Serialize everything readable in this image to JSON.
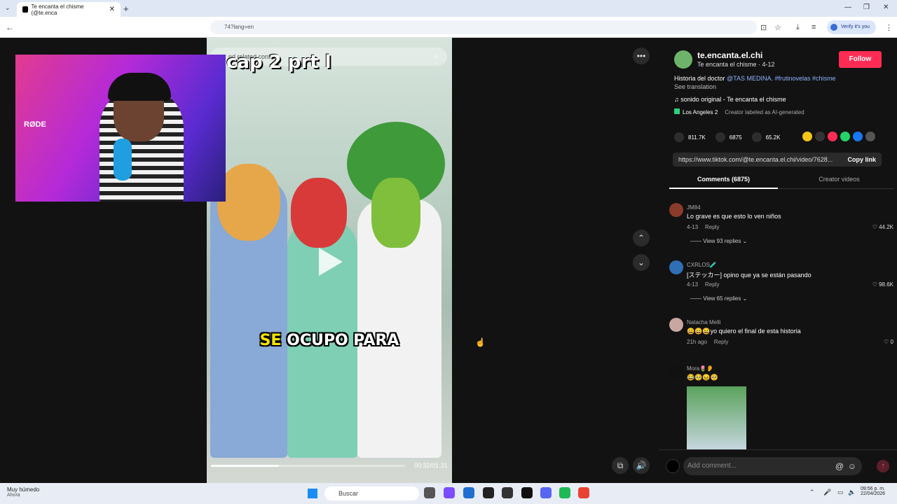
{
  "browser": {
    "tab_title": "Te encanta el chisme (@te.enca",
    "tab_close": "✕",
    "new_tab": "+",
    "url_fragment": "74?lang=en",
    "verify_label": "Verify it's you"
  },
  "webcam": {
    "mic_brand": "RØDE"
  },
  "video": {
    "search_placeholder": "nd related content",
    "title_overlay": "cap 2 prt l",
    "caption_highlight": "SE",
    "caption_rest": " OCUPO PARA",
    "time": "00:32/01:31",
    "progress_fraction": 0.35
  },
  "creator": {
    "username": "te.encanta.el.chi",
    "subtitle": "Te encanta el chisme · 4-12",
    "follow_label": "Follow",
    "description_prefix": "Historia del doctor ",
    "description_tags": "@TAS MEDINA. #frutinovelas #chisme",
    "see_translation": "See translation",
    "sound": "♫  sonido original - Te encanta el chisme",
    "location": "Los Angeles  2",
    "ai_label": "Creator labeled as AI-generated",
    "likes": "811.7K",
    "comments_count": "6875",
    "saves": "65.2K",
    "url": "https://www.tiktok.com/@te.encanta.el.chi/video/7628...",
    "copy_link": "Copy link"
  },
  "tabs": {
    "comments": "Comments (6875)",
    "creator_videos": "Creator videos"
  },
  "comments": [
    {
      "name": "JM84",
      "text": "Lo grave es que esto lo ven niños",
      "date": "4-13",
      "reply": "Reply",
      "likes": "♡ 44.2K",
      "replies": "—— View 93 replies ⌄"
    },
    {
      "name": "CXRLOS🧪",
      "text": "[ステッカー] opino que ya se están pasando",
      "date": "4-13",
      "reply": "Reply",
      "likes": "♡ 98.6K",
      "replies": "—— View 65 replies ⌄"
    },
    {
      "name": "Natacha Melli",
      "text": "😄😄😄yo quiero el final de esta historia",
      "date": "21h ago",
      "reply": "Reply",
      "likes": "♡ 0"
    },
    {
      "name": "Mora🌷👂",
      "text": "😂🥺😖🥺"
    }
  ],
  "add_comment": {
    "placeholder": "Add comment..."
  },
  "taskbar": {
    "weather": "Muy húmedo",
    "weather_sub": "Ahora",
    "search": "Buscar",
    "time": "09:56 p. m.",
    "date": "22/04/2026"
  },
  "colors": {
    "follow": "#fe2c55",
    "tag": "#8fb4ff",
    "caption_highlight": "#f5e400"
  }
}
